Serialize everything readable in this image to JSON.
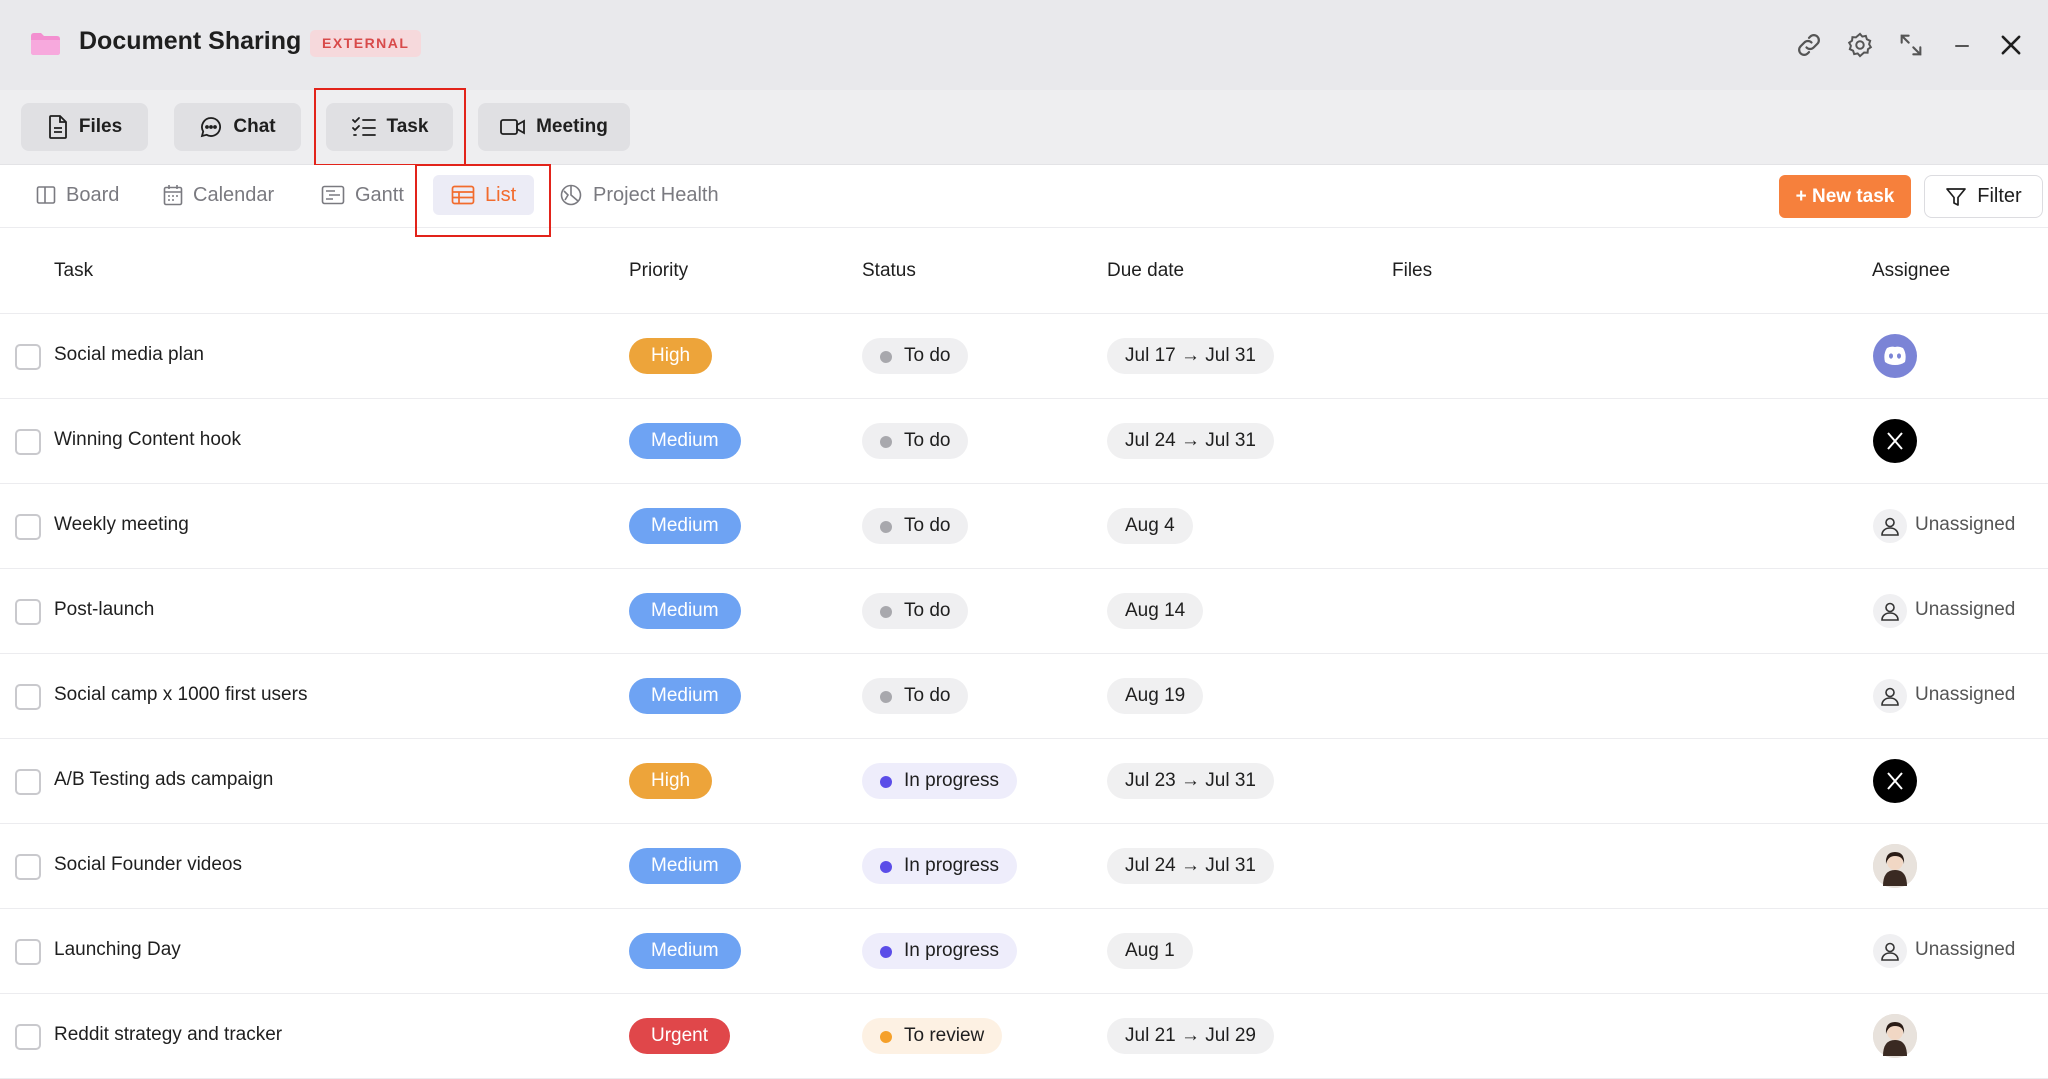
{
  "window": {
    "title": "Document Sharing",
    "badge": "EXTERNAL",
    "icons": [
      "link-icon",
      "gear-icon",
      "expand-icon",
      "minimize-icon",
      "close-icon"
    ]
  },
  "main_tabs": [
    {
      "label": "Files",
      "icon": "file-icon"
    },
    {
      "label": "Chat",
      "icon": "chat-icon"
    },
    {
      "label": "Task",
      "icon": "checklist-icon",
      "active": true
    },
    {
      "label": "Meeting",
      "icon": "video-icon"
    }
  ],
  "view_tabs": [
    {
      "label": "Board",
      "icon": "board-icon"
    },
    {
      "label": "Calendar",
      "icon": "calendar-icon"
    },
    {
      "label": "Gantt",
      "icon": "gantt-icon"
    },
    {
      "label": "List",
      "icon": "list-icon",
      "active": true
    },
    {
      "label": "Project Health",
      "icon": "health-icon"
    }
  ],
  "toolbar": {
    "new_task_label": "+ New task",
    "filter_label": "Filter"
  },
  "columns": {
    "task": "Task",
    "priority": "Priority",
    "status": "Status",
    "due_date": "Due date",
    "files": "Files",
    "assignee": "Assignee"
  },
  "colors": {
    "priority_high": "#eda43a",
    "priority_medium": "#6ea3f3",
    "priority_urgent": "#e0474a",
    "status_todo_bg": "#efeff1",
    "status_todo_dot": "#a8a8ad",
    "status_progress_bg": "#eeedfb",
    "status_progress_dot": "#5b4de8",
    "status_review_bg": "#fdf1e3",
    "status_review_dot": "#f5a02a",
    "accent": "#f6803c"
  },
  "rows": [
    {
      "task": "Social media plan",
      "priority": "High",
      "status": "To do",
      "due": "Jul 17 → Jul 31",
      "assignee": "discord-avatar"
    },
    {
      "task": "Winning Content hook",
      "priority": "Medium",
      "status": "To do",
      "due": "Jul 24 → Jul 31",
      "assignee": "x-avatar"
    },
    {
      "task": "Weekly meeting",
      "priority": "Medium",
      "status": "To do",
      "due": "Aug 4",
      "assignee": "Unassigned"
    },
    {
      "task": "Post-launch",
      "priority": "Medium",
      "status": "To do",
      "due": "Aug 14",
      "assignee": "Unassigned"
    },
    {
      "task": "Social camp x 1000 first users",
      "priority": "Medium",
      "status": "To do",
      "due": "Aug 19",
      "assignee": "Unassigned"
    },
    {
      "task": "A/B Testing ads campaign",
      "priority": "High",
      "status": "In progress",
      "due": "Jul 23 → Jul 31",
      "assignee": "x-avatar"
    },
    {
      "task": "Social Founder videos",
      "priority": "Medium",
      "status": "In progress",
      "due": "Jul 24 → Jul 31",
      "assignee": "person-avatar"
    },
    {
      "task": "Launching Day",
      "priority": "Medium",
      "status": "In progress",
      "due": "Aug 1",
      "assignee": "Unassigned"
    },
    {
      "task": "Reddit strategy and tracker",
      "priority": "Urgent",
      "status": "To review",
      "due": "Jul 21 → Jul 29",
      "assignee": "person-avatar"
    }
  ]
}
